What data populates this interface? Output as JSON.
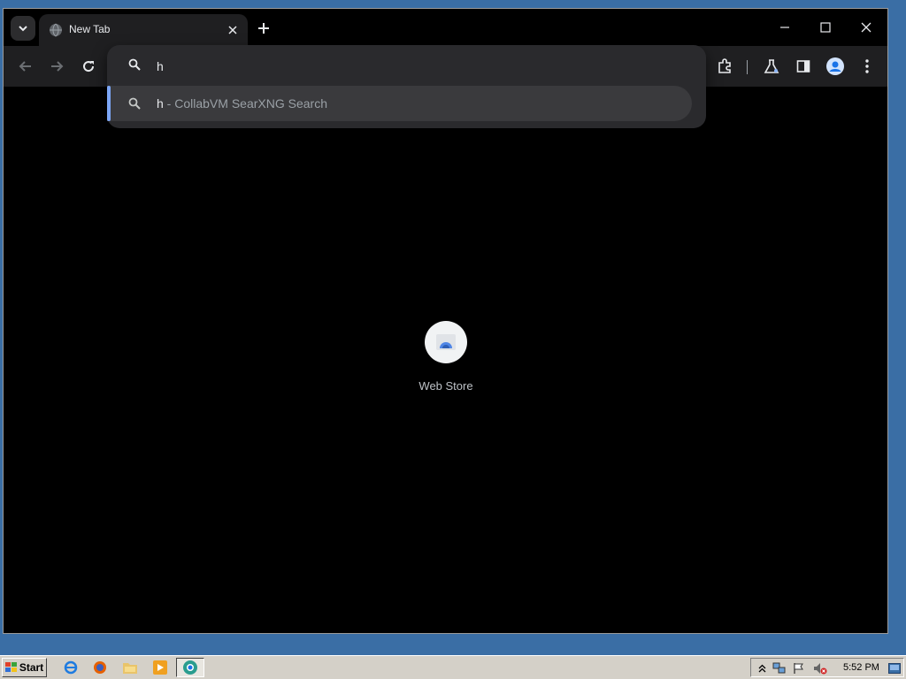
{
  "tab": {
    "title": "New Tab"
  },
  "omnibox": {
    "value": "h",
    "suggestion": {
      "query": "h",
      "rest": " - CollabVM SearXNG Search"
    }
  },
  "shortcut": {
    "label": "Web Store"
  },
  "taskbar": {
    "start_label": "Start",
    "clock": "5:52 PM"
  },
  "icons": {
    "tab_list": "chevron-down-icon",
    "tab_favicon": "globe-icon",
    "tab_close": "close-icon",
    "new_tab": "plus-icon",
    "back": "arrow-left-icon",
    "forward": "arrow-right-icon",
    "reload": "reload-icon",
    "search": "search-icon",
    "extensions": "puzzle-icon",
    "labs": "flask-icon",
    "side_panel": "side-panel-icon",
    "profile": "profile-icon",
    "menu": "kebab-menu-icon"
  },
  "colors": {
    "desktop": "#3a6ea5",
    "chrome_dark": "#1f1f21",
    "suggestion_accent": "#7ca6f5",
    "taskbar": "#d4d0c8"
  }
}
